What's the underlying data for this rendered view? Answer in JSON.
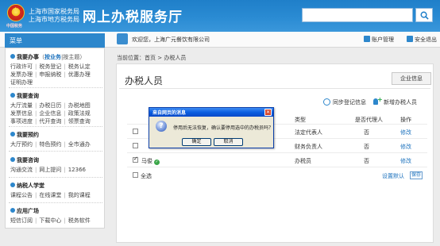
{
  "header": {
    "chinatax": "中国税务",
    "bureau_national": "上海市国家税务局",
    "bureau_local": "上海市地方税务局",
    "site_title": "网上办税服务厅",
    "search": {
      "placeholder": ""
    }
  },
  "topbar": {
    "menu_label": "菜单",
    "welcome": "欢迎您，上海广元餐饮有限公司",
    "account": "账户管理",
    "logout": "安全退出"
  },
  "sidebar": {
    "sections": [
      {
        "title": "我要办事",
        "paren_open": "（",
        "hl": "按业务",
        "sep": "|",
        "alt": "按主题",
        "paren_close": "）",
        "links": [
          [
            "行政许可",
            "税务登记",
            "税务认定"
          ],
          [
            "发票办理",
            "申报纳税",
            "优惠办理"
          ],
          [
            "证明办理"
          ]
        ]
      },
      {
        "title": "我要查询",
        "links": [
          [
            "大厅流量",
            "办税日历",
            "办税地图"
          ],
          [
            "发票信息",
            "企业信息",
            "政策法规"
          ],
          [
            "事项进度",
            "代开查询",
            "领票查询"
          ]
        ]
      },
      {
        "title": "我要预约",
        "links": [
          [
            "大厅预约",
            "特色预约",
            "全市通办"
          ]
        ]
      },
      {
        "title": "我要咨询",
        "links": [
          [
            "沟通交流",
            "网上提问",
            "12366"
          ]
        ]
      },
      {
        "title": "纳税人学堂",
        "links": [
          [
            "课程公告",
            "在线课堂",
            "我的课程"
          ]
        ]
      },
      {
        "title": "应用广场",
        "links": [
          [
            "短信订阅",
            "下载中心",
            "税务软件"
          ]
        ]
      }
    ]
  },
  "breadcrumb": {
    "prefix": "当前位置：",
    "home": "首页",
    "gt": ">",
    "current": "办税人员"
  },
  "main": {
    "title": "办税人员",
    "biz_info_btn": "企业信息",
    "sync_btn": "同步登记信息",
    "add_btn": "新增办税人员",
    "table": {
      "headers": [
        "类型",
        "是否代理人",
        "操作"
      ],
      "rows": [
        {
          "type": "法定代表人",
          "agent": "否",
          "action": "修改",
          "checked": false
        },
        {
          "type": "财务负责人",
          "agent": "否",
          "action": "修改",
          "checked": false
        },
        {
          "name": "马俊",
          "type": "办税员",
          "agent": "否",
          "action": "修改",
          "checked": true
        }
      ]
    },
    "select_all": "全选",
    "set_default": "设置默认",
    "save": "保存"
  },
  "dialog": {
    "title": "来自网页的消息",
    "message": "停用后无法恢复，确认要停用选中的办税员吗？",
    "ok": "确定",
    "cancel": "取消"
  },
  "colors": {
    "header_blue": "#1f7fc9",
    "link_blue": "#1e73be",
    "dialog_title": "#0a5ee0"
  }
}
